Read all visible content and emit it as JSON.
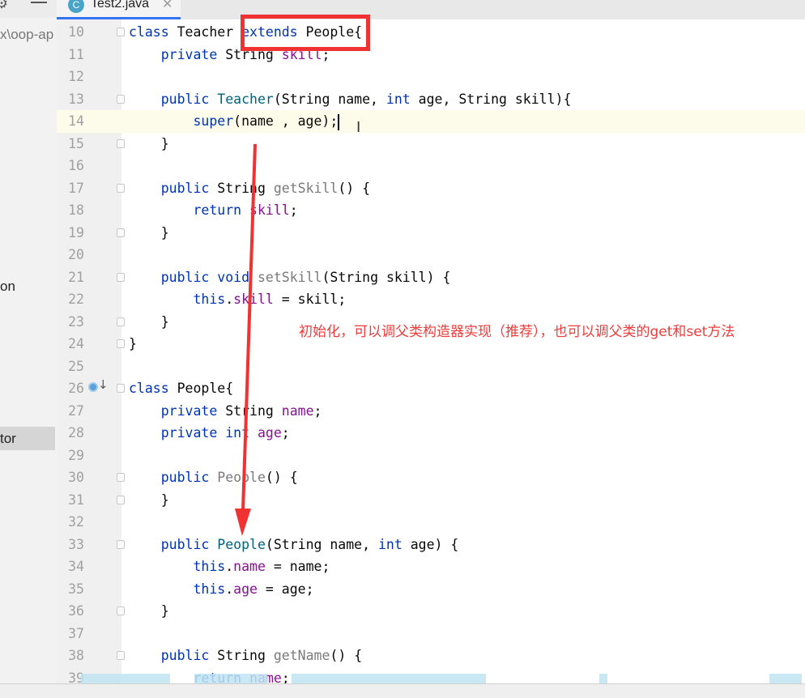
{
  "sidebar": {
    "path_fragment": "x\\oop-ap",
    "items": [
      "on",
      "tor"
    ],
    "selected": "tor"
  },
  "tabs": [
    {
      "label": "Test2.java",
      "icon": "java-class-icon",
      "active": true
    }
  ],
  "editor": {
    "current_line": 14,
    "lines": [
      {
        "n": "10",
        "t": [
          [
            "class",
            "k"
          ],
          [
            " Teacher ",
            ""
          ],
          [
            "extends",
            "k"
          ],
          [
            " People{",
            ""
          ]
        ]
      },
      {
        "n": "11",
        "t": [
          [
            "    ",
            ""
          ],
          [
            "private",
            "k"
          ],
          [
            " String ",
            ""
          ],
          [
            "skill",
            "f"
          ],
          [
            ";",
            ""
          ]
        ]
      },
      {
        "n": "12",
        "t": []
      },
      {
        "n": "13",
        "t": [
          [
            "    ",
            ""
          ],
          [
            "public",
            "k"
          ],
          [
            " ",
            ""
          ],
          [
            "Teacher",
            "m"
          ],
          [
            "(String name, ",
            ""
          ],
          [
            "int",
            "k"
          ],
          [
            " age, String skill){",
            ""
          ]
        ]
      },
      {
        "n": "14",
        "t": [
          [
            "        ",
            ""
          ],
          [
            "super",
            "k"
          ],
          [
            "(name , age);",
            ""
          ]
        ]
      },
      {
        "n": "15",
        "t": [
          [
            "    }",
            ""
          ]
        ]
      },
      {
        "n": "16",
        "t": []
      },
      {
        "n": "17",
        "t": [
          [
            "    ",
            ""
          ],
          [
            "public",
            "k"
          ],
          [
            " String ",
            ""
          ],
          [
            "getSkill",
            "g"
          ],
          [
            "() {",
            ""
          ]
        ]
      },
      {
        "n": "18",
        "t": [
          [
            "        ",
            ""
          ],
          [
            "return",
            "k"
          ],
          [
            " ",
            ""
          ],
          [
            "skill",
            "f"
          ],
          [
            ";",
            ""
          ]
        ]
      },
      {
        "n": "19",
        "t": [
          [
            "    }",
            ""
          ]
        ]
      },
      {
        "n": "20",
        "t": []
      },
      {
        "n": "21",
        "t": [
          [
            "    ",
            ""
          ],
          [
            "public",
            "k"
          ],
          [
            " ",
            ""
          ],
          [
            "void",
            "k"
          ],
          [
            " ",
            ""
          ],
          [
            "setSkill",
            "g"
          ],
          [
            "(String skill) {",
            ""
          ]
        ]
      },
      {
        "n": "22",
        "t": [
          [
            "        ",
            ""
          ],
          [
            "this",
            "k"
          ],
          [
            ".",
            ""
          ],
          [
            "skill",
            "f"
          ],
          [
            " = skill;",
            ""
          ]
        ]
      },
      {
        "n": "23",
        "t": [
          [
            "    }",
            ""
          ]
        ]
      },
      {
        "n": "24",
        "t": [
          [
            "}",
            ""
          ]
        ]
      },
      {
        "n": "25",
        "t": []
      },
      {
        "n": "26",
        "t": [
          [
            "class",
            "k"
          ],
          [
            " People{",
            ""
          ]
        ]
      },
      {
        "n": "27",
        "t": [
          [
            "    ",
            ""
          ],
          [
            "private",
            "k"
          ],
          [
            " String ",
            ""
          ],
          [
            "name",
            "f"
          ],
          [
            ";",
            ""
          ]
        ]
      },
      {
        "n": "28",
        "t": [
          [
            "    ",
            ""
          ],
          [
            "private",
            "k"
          ],
          [
            " ",
            ""
          ],
          [
            "int",
            "k"
          ],
          [
            " ",
            ""
          ],
          [
            "age",
            "f"
          ],
          [
            ";",
            ""
          ]
        ]
      },
      {
        "n": "29",
        "t": []
      },
      {
        "n": "30",
        "t": [
          [
            "    ",
            ""
          ],
          [
            "public",
            "k"
          ],
          [
            " ",
            ""
          ],
          [
            "People",
            "g"
          ],
          [
            "() {",
            ""
          ]
        ]
      },
      {
        "n": "31",
        "t": [
          [
            "    }",
            ""
          ]
        ]
      },
      {
        "n": "32",
        "t": []
      },
      {
        "n": "33",
        "t": [
          [
            "    ",
            ""
          ],
          [
            "public",
            "k"
          ],
          [
            " ",
            ""
          ],
          [
            "People",
            "m"
          ],
          [
            "(String name, ",
            ""
          ],
          [
            "int",
            "k"
          ],
          [
            " age) {",
            ""
          ]
        ]
      },
      {
        "n": "34",
        "t": [
          [
            "        ",
            ""
          ],
          [
            "this",
            "k"
          ],
          [
            ".",
            ""
          ],
          [
            "name",
            "f"
          ],
          [
            " = name;",
            ""
          ]
        ]
      },
      {
        "n": "35",
        "t": [
          [
            "        ",
            ""
          ],
          [
            "this",
            "k"
          ],
          [
            ".",
            ""
          ],
          [
            "age",
            "f"
          ],
          [
            " = age;",
            ""
          ]
        ]
      },
      {
        "n": "36",
        "t": [
          [
            "    }",
            ""
          ]
        ]
      },
      {
        "n": "37",
        "t": []
      },
      {
        "n": "38",
        "t": [
          [
            "    ",
            ""
          ],
          [
            "public",
            "k"
          ],
          [
            " String ",
            ""
          ],
          [
            "getName",
            "g"
          ],
          [
            "() {",
            ""
          ]
        ]
      },
      {
        "n": "39",
        "t": [
          [
            "        ",
            ""
          ],
          [
            "return",
            "k"
          ],
          [
            " ",
            ""
          ],
          [
            "name",
            "f"
          ],
          [
            ";",
            ""
          ]
        ]
      }
    ],
    "fold_lines": [
      "10",
      "13",
      "15",
      "17",
      "19",
      "21",
      "23",
      "24",
      "26",
      "30",
      "31",
      "33",
      "36",
      "38"
    ]
  },
  "annotation": {
    "text": "初始化，可以调父类构造器实现（推荐），也可以调父类的get和set方法",
    "color": "#f23a3a"
  },
  "colors": {
    "keyword": "#0033b3",
    "method": "#00627a",
    "field": "#871094",
    "annotation_box": "#f03232",
    "accent": "#3574f0"
  }
}
